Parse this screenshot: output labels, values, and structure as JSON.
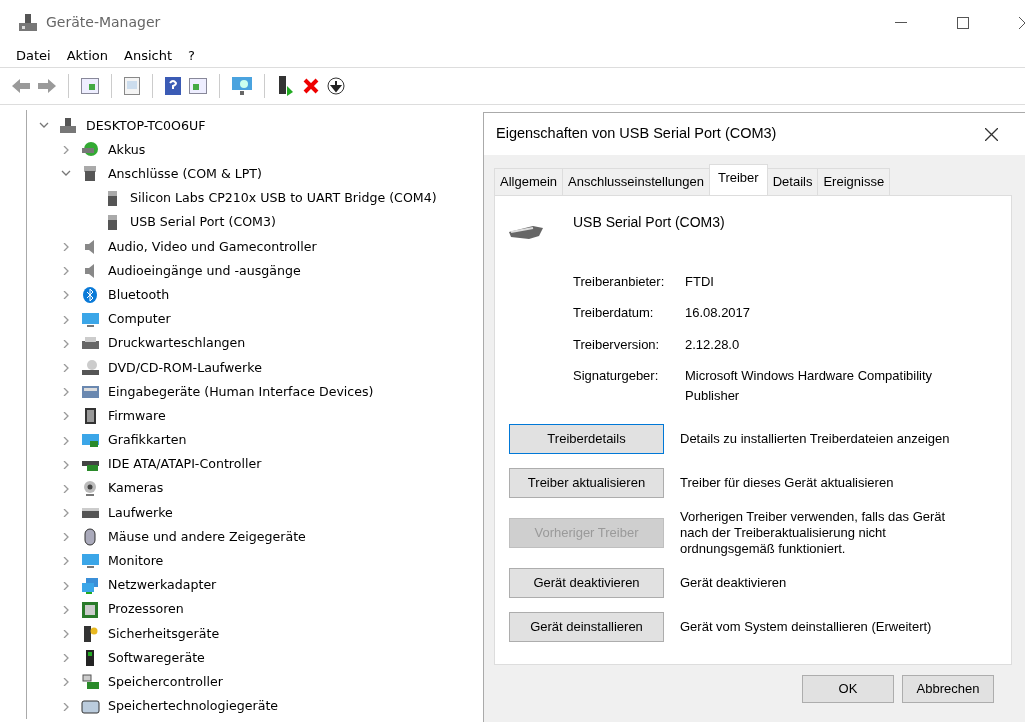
{
  "window": {
    "title": "Geräte-Manager"
  },
  "menu": [
    "Datei",
    "Aktion",
    "Ansicht",
    "?"
  ],
  "tree": {
    "label": "DESKTOP-TC0O6UF",
    "expanded": true,
    "children": [
      {
        "label": "Akkus",
        "expanded": false
      },
      {
        "label": "Anschlüsse (COM & LPT)",
        "expanded": true,
        "children": [
          {
            "label": "Silicon Labs CP210x USB to UART Bridge (COM4)"
          },
          {
            "label": "USB Serial Port (COM3)"
          }
        ]
      },
      {
        "label": "Audio, Video und Gamecontroller",
        "expanded": false
      },
      {
        "label": "Audioeingänge und -ausgänge",
        "expanded": false
      },
      {
        "label": "Bluetooth",
        "expanded": false
      },
      {
        "label": "Computer",
        "expanded": false
      },
      {
        "label": "Druckwarteschlangen",
        "expanded": false
      },
      {
        "label": "DVD/CD-ROM-Laufwerke",
        "expanded": false
      },
      {
        "label": "Eingabegeräte (Human Interface Devices)",
        "expanded": false
      },
      {
        "label": "Firmware",
        "expanded": false
      },
      {
        "label": "Grafikkarten",
        "expanded": false
      },
      {
        "label": "IDE ATA/ATAPI-Controller",
        "expanded": false
      },
      {
        "label": "Kameras",
        "expanded": false
      },
      {
        "label": "Laufwerke",
        "expanded": false
      },
      {
        "label": "Mäuse und andere Zeigegeräte",
        "expanded": false
      },
      {
        "label": "Monitore",
        "expanded": false
      },
      {
        "label": "Netzwerkadapter",
        "expanded": false
      },
      {
        "label": "Prozessoren",
        "expanded": false
      },
      {
        "label": "Sicherheitsgeräte",
        "expanded": false
      },
      {
        "label": "Softwaregeräte",
        "expanded": false
      },
      {
        "label": "Speichercontroller",
        "expanded": false
      },
      {
        "label": "Speichertechnologiegeräte",
        "expanded": false
      }
    ]
  },
  "dialog": {
    "title": "Eigenschaften von USB Serial Port (COM3)",
    "tabs": [
      {
        "label": "Allgemein",
        "selected": false
      },
      {
        "label": "Anschlusseinstellungen",
        "selected": false
      },
      {
        "label": "Treiber",
        "selected": true
      },
      {
        "label": "Details",
        "selected": false
      },
      {
        "label": "Ereignisse",
        "selected": false
      }
    ],
    "device_name": "USB Serial Port (COM3)",
    "properties": [
      {
        "label": "Treiberanbieter:",
        "value": "FTDI"
      },
      {
        "label": "Treiberdatum:",
        "value": "16.08.2017"
      },
      {
        "label": "Treiberversion:",
        "value": "2.12.28.0"
      },
      {
        "label": "Signaturgeber:",
        "value": "Microsoft Windows Hardware Compatibility Publisher"
      }
    ],
    "actions": [
      {
        "button": "Treiberdetails",
        "description": "Details zu installierten Treiberdateien anzeigen",
        "disabled": false
      },
      {
        "button": "Treiber aktualisieren",
        "description": "Treiber für dieses Gerät aktualisieren",
        "disabled": false
      },
      {
        "button": "Vorheriger Treiber",
        "description": "Vorherigen Treiber verwenden, falls das Gerät nach der Treiberaktualisierung nicht ordnungsgemäß funktioniert.",
        "disabled": true
      },
      {
        "button": "Gerät deaktivieren",
        "description": "Gerät deaktivieren",
        "disabled": false
      },
      {
        "button": "Gerät deinstallieren",
        "description": "Gerät vom System deinstallieren (Erweitert)",
        "disabled": false
      }
    ],
    "buttons": [
      "OK",
      "Abbrechen"
    ]
  }
}
